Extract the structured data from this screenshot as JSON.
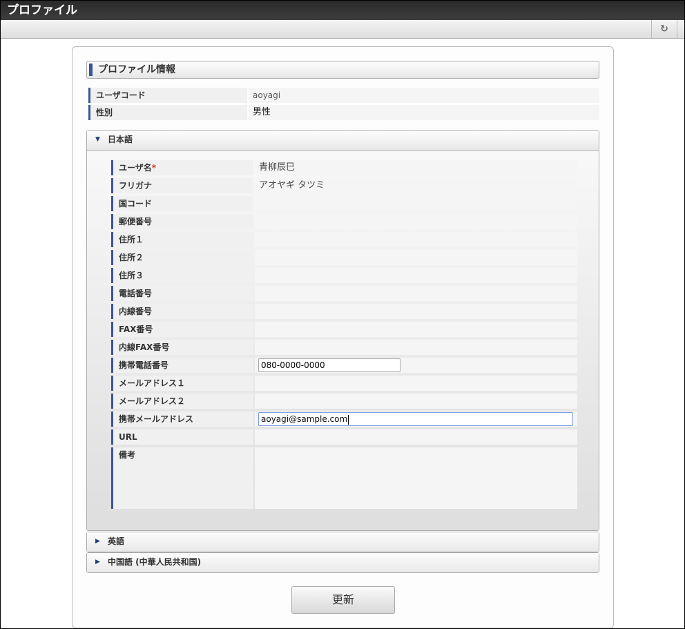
{
  "window": {
    "title": "プロファイル"
  },
  "toolbar": {
    "refresh_icon": "↻"
  },
  "section": {
    "title": "プロファイル情報"
  },
  "basic": [
    {
      "label": "ユーザコード",
      "value": "aoyagi"
    },
    {
      "label": "性別",
      "value": "男性"
    }
  ],
  "japanese": {
    "title": "日本語",
    "fields": [
      {
        "label": "ユーザ名",
        "value": "青柳辰巳",
        "required": "*"
      },
      {
        "label": "フリガナ",
        "value": "アオヤギ タツミ"
      },
      {
        "label": "国コード",
        "value": ""
      },
      {
        "label": "郵便番号",
        "value": ""
      },
      {
        "label": "住所１",
        "value": ""
      },
      {
        "label": "住所２",
        "value": ""
      },
      {
        "label": "住所３",
        "value": ""
      },
      {
        "label": "電話番号",
        "value": ""
      },
      {
        "label": "内線番号",
        "value": ""
      },
      {
        "label": "FAX番号",
        "value": ""
      },
      {
        "label": "内線FAX番号",
        "value": ""
      },
      {
        "label": "携帯電話番号",
        "value": "080-0000-0000"
      },
      {
        "label": "メールアドレス１",
        "value": ""
      },
      {
        "label": "メールアドレス２",
        "value": ""
      },
      {
        "label": "携帯メールアドレス",
        "value": "aoyagi@sample.com"
      },
      {
        "label": "URL",
        "value": ""
      },
      {
        "label": "備考",
        "value": ""
      }
    ]
  },
  "english": {
    "title": "英語"
  },
  "chinese": {
    "title": "中国語 (中華人民共和国)"
  },
  "update_label": "更新"
}
